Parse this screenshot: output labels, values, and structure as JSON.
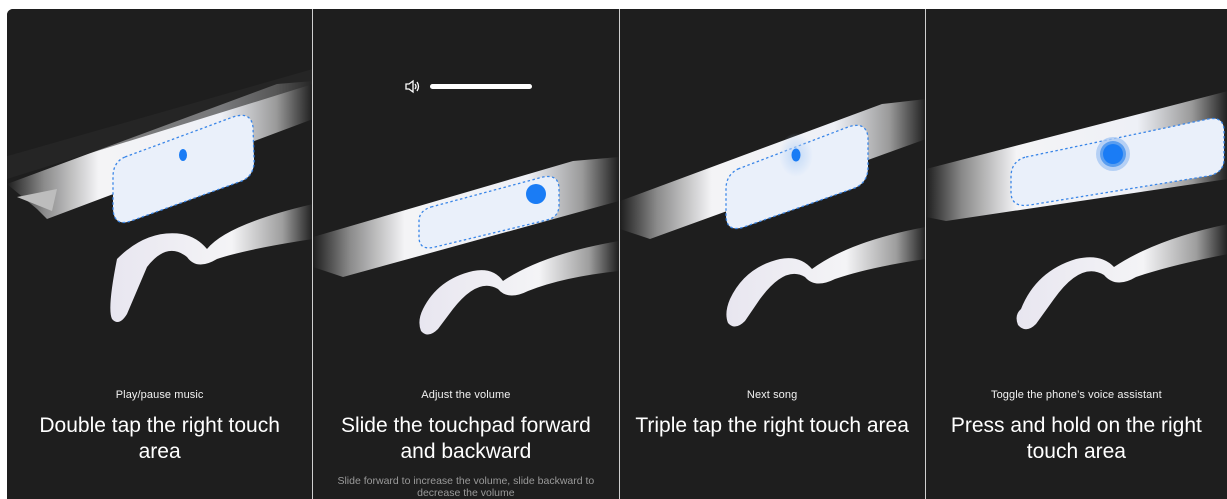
{
  "panels": [
    {
      "id": "play-pause",
      "subtitle": "Play/pause music",
      "title": "Double tap the right touch area",
      "description": ""
    },
    {
      "id": "volume",
      "subtitle": "Adjust the volume",
      "title": "Slide the touchpad forward and backward",
      "description": "Slide forward to increase the volume, slide backward to decrease the volume",
      "volume_level": 1.0
    },
    {
      "id": "next-song",
      "subtitle": "Next song",
      "title": "Triple tap the right touch area",
      "description": ""
    },
    {
      "id": "voice-assistant",
      "subtitle": "Toggle the phone’s voice assistant",
      "title": "Press and hold on the right touch area",
      "description": ""
    }
  ],
  "colors": {
    "background": "#1e1e1e",
    "accent_blue": "#1a7cf5",
    "touchpad_outline": "#3a86e8"
  },
  "icons": {
    "volume": "speaker-icon"
  }
}
